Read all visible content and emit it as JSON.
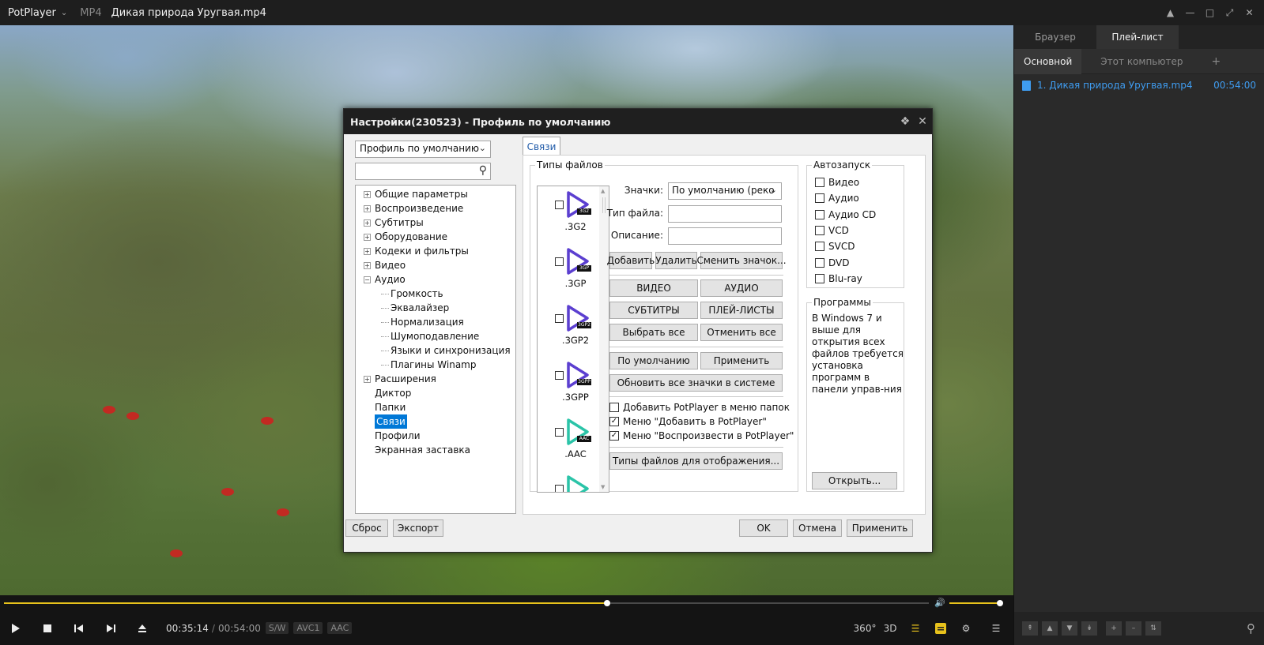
{
  "titlebar": {
    "app_name": "PotPlayer",
    "format": "MP4",
    "title": "Дикая природа Уругвая.mp4"
  },
  "player": {
    "time_current": "00:35:14",
    "time_sep": "/",
    "time_total": "00:54:00",
    "tags": [
      "S/W",
      "AVC1",
      "AAC"
    ],
    "progress": 0.652,
    "volume": 1.0,
    "right_buttons": [
      "360°",
      "3D"
    ],
    "accent_color": "#e8c21c"
  },
  "panel": {
    "tabs": [
      "Браузер",
      "Плей-лист"
    ],
    "active_tab": "Плей-лист",
    "subtabs": [
      "Основной",
      "Этот компьютер"
    ],
    "add_label": "+",
    "items": [
      {
        "name": "1. Дикая природа Уругвая.mp4",
        "duration": "00:54:00"
      }
    ],
    "link_color": "#3f9cf0"
  },
  "dialog": {
    "title": "Настройки(230523) - Профиль по умолчанию",
    "profile": "Профиль по умолчанию",
    "tree": [
      {
        "label": "Общие параметры",
        "level": 0,
        "expandable": true
      },
      {
        "label": "Воспроизведение",
        "level": 0,
        "expandable": true
      },
      {
        "label": "Субтитры",
        "level": 0,
        "expandable": true
      },
      {
        "label": "Оборудование",
        "level": 0,
        "expandable": true
      },
      {
        "label": "Кодеки и фильтры",
        "level": 0,
        "expandable": true
      },
      {
        "label": "Видео",
        "level": 0,
        "expandable": true
      },
      {
        "label": "Аудио",
        "level": 0,
        "expandable": true,
        "expanded": true
      },
      {
        "label": "Громкость",
        "level": 1
      },
      {
        "label": "Эквалайзер",
        "level": 1
      },
      {
        "label": "Нормализация",
        "level": 1
      },
      {
        "label": "Шумоподавление",
        "level": 1
      },
      {
        "label": "Языки и синхронизация",
        "level": 1
      },
      {
        "label": "Плагины Winamp",
        "level": 1
      },
      {
        "label": "Расширения",
        "level": 0,
        "expandable": true
      },
      {
        "label": "Диктор",
        "level": 0
      },
      {
        "label": "Папки",
        "level": 0
      },
      {
        "label": "Связи",
        "level": 0,
        "selected": true
      },
      {
        "label": "Профили",
        "level": 0
      },
      {
        "label": "Экранная заставка",
        "level": 0
      }
    ],
    "tab": "Связи",
    "filetypes": {
      "group_title": "Типы файлов",
      "items": [
        {
          "ext": ".3G2",
          "badge": "3G2",
          "color": "#5b3fd0"
        },
        {
          "ext": ".3GP",
          "badge": "3GP",
          "color": "#5b3fd0"
        },
        {
          "ext": ".3GP2",
          "badge": "3GP2",
          "color": "#5b3fd0"
        },
        {
          "ext": ".3GPP",
          "badge": "3GPP",
          "color": "#5b3fd0"
        },
        {
          "ext": ".AAC",
          "badge": "AAC",
          "color": "#2bc4a8"
        },
        {
          "ext": "",
          "badge": "",
          "color": "#2bc4a8"
        }
      ],
      "icons_label": "Значки:",
      "icons_value": "По умолчанию (реко",
      "type_label": "Тип файла:",
      "desc_label": "Описание:",
      "add_btn": "Добавить",
      "remove_btn": "Удалить",
      "change_icon_btn": "Сменить значок...",
      "video_btn": "ВИДЕО",
      "audio_btn": "АУДИО",
      "subs_btn": "СУБТИТРЫ",
      "playlists_btn": "ПЛЕЙ-ЛИСТЫ",
      "select_all_btn": "Выбрать все",
      "deselect_all_btn": "Отменить все",
      "default_btn": "По умолчанию",
      "apply_btn": "Применить",
      "refresh_icons_btn": "Обновить все значки в системе",
      "opt_folder_menu": "Добавить PotPlayer в меню папок",
      "opt_add_menu": "Меню \"Добавить в PotPlayer\"",
      "opt_play_menu": "Меню \"Воспроизвести в PotPlayer\"",
      "opt_folder_menu_checked": false,
      "opt_add_menu_checked": true,
      "opt_play_menu_checked": true,
      "display_types_btn": "Типы файлов для отображения..."
    },
    "autorun": {
      "title": "Автозапуск",
      "items": [
        "Видео",
        "Аудио",
        "Аудио CD",
        "VCD",
        "SVCD",
        "DVD",
        "Blu-ray"
      ]
    },
    "programs": {
      "title": "Программы",
      "text": "В Windows 7 и выше для открытия всех файлов требуется установка программ в панели управ-ния",
      "open_btn": "Открыть..."
    },
    "reset_btn": "Сброс",
    "export_btn": "Экспорт",
    "ok_btn": "OK",
    "cancel_btn": "Отмена",
    "apply_btn": "Применить"
  }
}
